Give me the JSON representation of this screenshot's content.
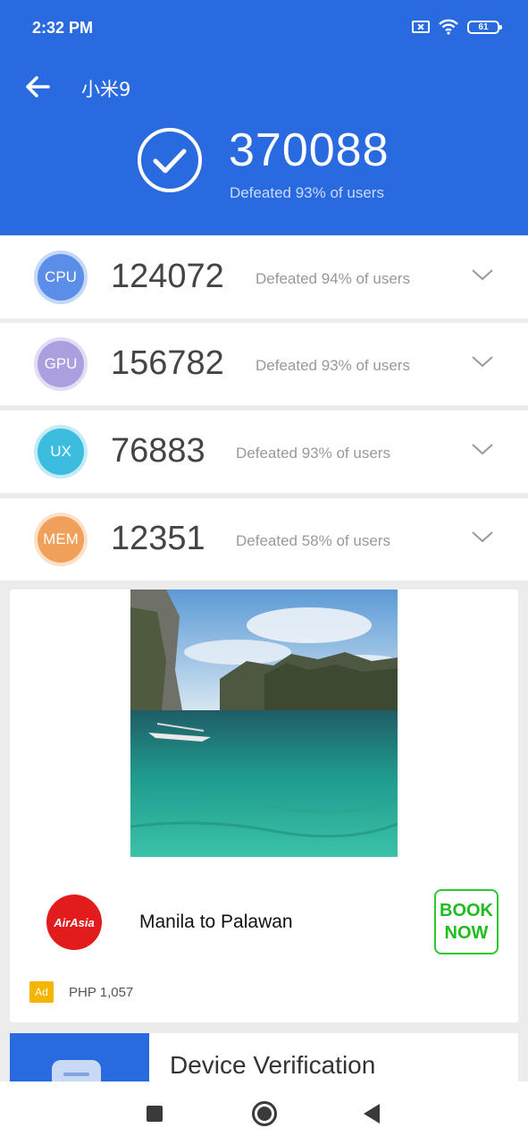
{
  "status_bar": {
    "time": "2:32 PM",
    "battery": "61"
  },
  "header": {
    "title": "小米9",
    "total_score": "370088",
    "total_defeat": "Defeated 93% of users"
  },
  "scores": [
    {
      "label": "CPU",
      "score": "124072",
      "defeat": "Defeated 94% of users",
      "color": "#5b8ee8",
      "ring": "#c6d8f8"
    },
    {
      "label": "GPU",
      "score": "156782",
      "defeat": "Defeated 93% of users",
      "color": "#ad9ee0",
      "ring": "#e2dcf4"
    },
    {
      "label": "UX",
      "score": "76883",
      "defeat": "Defeated 93% of users",
      "color": "#3bbde0",
      "ring": "#c3ebf6"
    },
    {
      "label": "MEM",
      "score": "12351",
      "defeat": "Defeated 58% of users",
      "color": "#f0a05a",
      "ring": "#fbe1c8"
    }
  ],
  "ad": {
    "brand": "AirAsia",
    "title": "Manila to Palawan",
    "cta": [
      "BOOK",
      "NOW"
    ],
    "tag": "Ad",
    "price": "PHP 1,057"
  },
  "device_verification": {
    "title": "Device Verification"
  }
}
